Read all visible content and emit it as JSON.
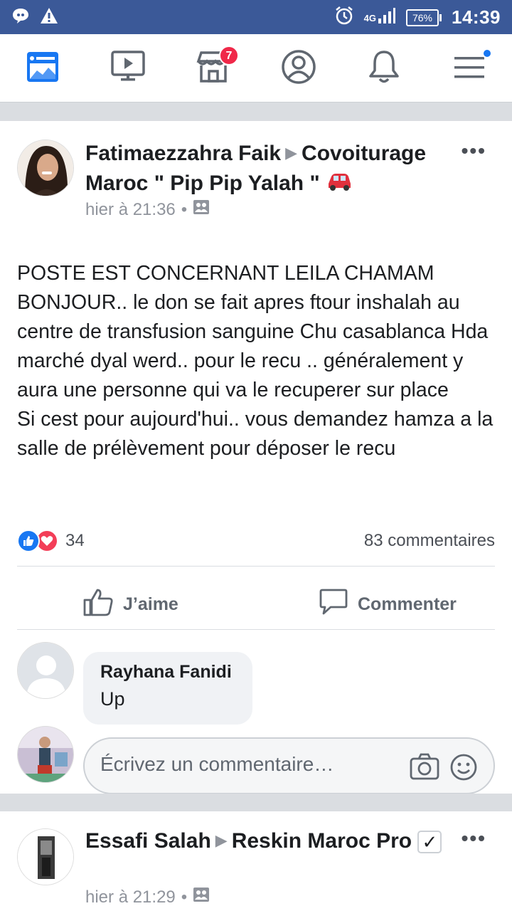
{
  "status_bar": {
    "network": "4G",
    "battery": "76%",
    "time": "14:39"
  },
  "nav": {
    "items": [
      {
        "name": "news-feed",
        "icon": "news-feed-icon"
      },
      {
        "name": "watch",
        "icon": "video-icon"
      },
      {
        "name": "marketplace",
        "icon": "marketplace-icon",
        "badge": "7"
      },
      {
        "name": "profile",
        "icon": "profile-icon"
      },
      {
        "name": "notifications",
        "icon": "bell-icon"
      },
      {
        "name": "menu",
        "icon": "menu-icon",
        "dot": true
      }
    ],
    "active_color": "#1877f2"
  },
  "post1": {
    "author": "Fatimaezzahra Faik",
    "group": "Covoiturage Maroc \" Pip Pip Yalah \"",
    "group_emoji": "🚗",
    "time": "hier à 21:36",
    "separator": "•",
    "more": "•••",
    "text": "POSTE EST CONCERNANT LEILA CHAMAM BONJOUR.. le don se fait apres ftour inshalah au centre de transfusion sanguine Chu casablanca Hda marché dyal werd.. pour le recu .. généralement y aura une personne qui va le recuperer sur place\nSi cest pour aujourd'hui.. vous demandez hamza a la salle de prélèvement pour déposer le recu",
    "reaction_count": "34",
    "comments_count": "83 commentaires",
    "like_label": "J’aime",
    "comment_label": "Commenter",
    "comment": {
      "author": "Rayhana Fanidi",
      "text": "Up"
    },
    "write_placeholder": "Écrivez un commentaire…"
  },
  "post2": {
    "author": "Essafi Salah",
    "group": "Reskin Maroc Pro",
    "verified": "✓",
    "time": "hier à 21:29",
    "separator": "•",
    "more": "•••"
  }
}
